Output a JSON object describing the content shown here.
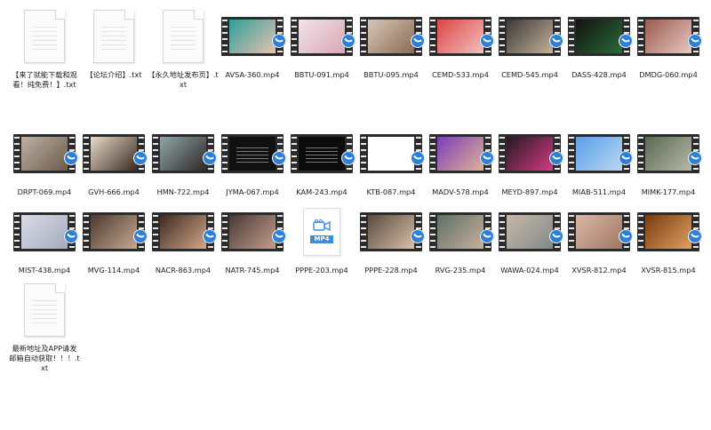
{
  "files": [
    {
      "label": "【来了就能下载和观看！纯免费！】.txt",
      "kind": "txt"
    },
    {
      "label": "【论坛介绍】.txt",
      "kind": "txt"
    },
    {
      "label": "【永久地址发布页】.txt",
      "kind": "txt"
    },
    {
      "label": "AVSA-360.mp4",
      "kind": "video",
      "colors": [
        "#2e9e9a",
        "#e6c3b0"
      ]
    },
    {
      "label": "BBTU-091.mp4",
      "kind": "video",
      "colors": [
        "#f2e4ea",
        "#d8a7b5"
      ]
    },
    {
      "label": "BBTU-095.mp4",
      "kind": "video",
      "colors": [
        "#d7c7b6",
        "#8a6b55"
      ]
    },
    {
      "label": "CEMD-533.mp4",
      "kind": "video",
      "colors": [
        "#e04444",
        "#f0c0c0"
      ]
    },
    {
      "label": "CEMD-545.mp4",
      "kind": "video",
      "colors": [
        "#3b3a36",
        "#c4b09a"
      ]
    },
    {
      "label": "DASS-428.mp4",
      "kind": "video",
      "colors": [
        "#111111",
        "#2c6a3a"
      ]
    },
    {
      "label": "DMDG-060.mp4",
      "kind": "video",
      "colors": [
        "#9a5a52",
        "#e8c8c0"
      ]
    },
    {
      "label": "DRPT-069.mp4",
      "kind": "video",
      "colors": [
        "#bdb2a6",
        "#6b5a4a"
      ]
    },
    {
      "label": "GVH-666.mp4",
      "kind": "video",
      "colors": [
        "#e7dbc9",
        "#3a2a22"
      ]
    },
    {
      "label": "HMN-722.mp4",
      "kind": "video",
      "colors": [
        "#8fa6a8",
        "#302826"
      ]
    },
    {
      "label": "JYMA-067.mp4",
      "kind": "video",
      "colors": [
        "#111111",
        "#222222"
      ]
    },
    {
      "label": "KAM-243.mp4",
      "kind": "video",
      "colors": [
        "#0c0c0c",
        "#1d1d1d"
      ]
    },
    {
      "label": "KTB-087.mp4",
      "kind": "video",
      "colors": [
        "#ffffff",
        "#f4f4f4"
      ]
    },
    {
      "label": "MADV-578.mp4",
      "kind": "video",
      "colors": [
        "#7a3fb8",
        "#e0b098"
      ]
    },
    {
      "label": "MEYD-897.mp4",
      "kind": "video",
      "colors": [
        "#241a1f",
        "#d43b86"
      ]
    },
    {
      "label": "MIAB-511.mp4",
      "kind": "video",
      "colors": [
        "#5aa0e8",
        "#b9d6f3"
      ]
    },
    {
      "label": "MIMK-177.mp4",
      "kind": "video",
      "colors": [
        "#5a6a55",
        "#b7b7a8"
      ]
    },
    {
      "label": "MIST-438.mp4",
      "kind": "video",
      "colors": [
        "#d9dce6",
        "#a6aabc"
      ]
    },
    {
      "label": "MVG-114.mp4",
      "kind": "video",
      "colors": [
        "#4a3a30",
        "#c8a890"
      ]
    },
    {
      "label": "NACR-863.mp4",
      "kind": "video",
      "colors": [
        "#3c2a22",
        "#d4a688"
      ]
    },
    {
      "label": "NATR-745.mp4",
      "kind": "video",
      "colors": [
        "#473a35",
        "#c59e8c"
      ]
    },
    {
      "label": "PPPE-203.mp4",
      "kind": "mp4",
      "tag": "MP4"
    },
    {
      "label": "PPPE-228.mp4",
      "kind": "video",
      "colors": [
        "#584a3e",
        "#d9c0a8"
      ]
    },
    {
      "label": "RVG-235.mp4",
      "kind": "video",
      "colors": [
        "#5d7066",
        "#c7b09c"
      ]
    },
    {
      "label": "WAWA-024.mp4",
      "kind": "video",
      "colors": [
        "#c9b8a6",
        "#7f8a8a"
      ]
    },
    {
      "label": "XVSR-812.mp4",
      "kind": "video",
      "colors": [
        "#d9b6a4",
        "#a07864"
      ]
    },
    {
      "label": "XVSR-815.mp4",
      "kind": "video",
      "colors": [
        "#7a3a10",
        "#e0a060"
      ]
    },
    {
      "label": "最新地址及APP请发邮箱自动获取！！！.txt",
      "kind": "txt"
    }
  ]
}
